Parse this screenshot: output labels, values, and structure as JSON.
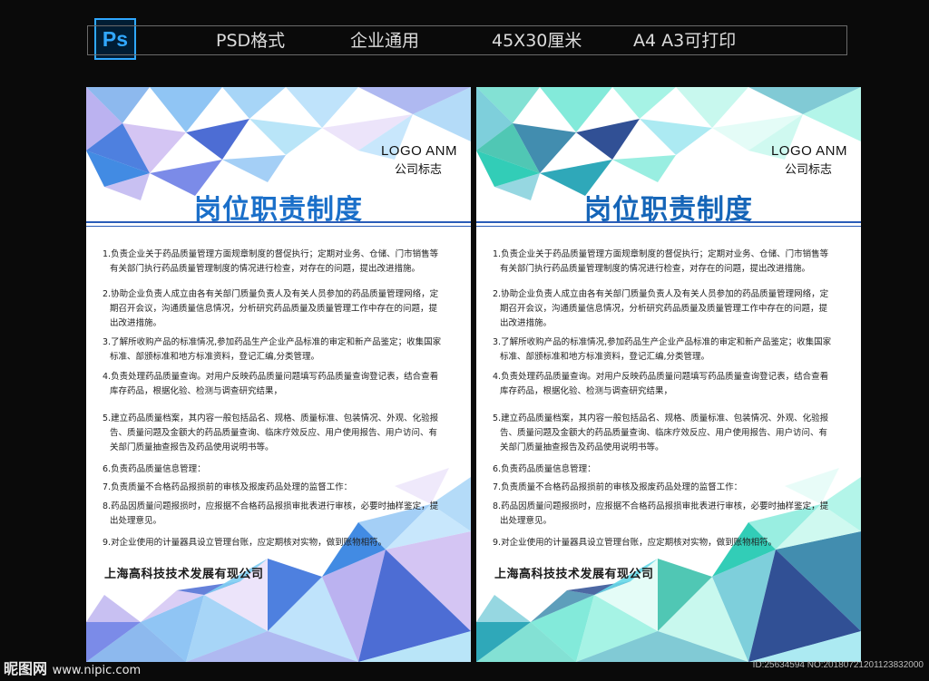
{
  "header": {
    "ps_label": "Ps",
    "format": "PSD格式",
    "usage": "企业通用",
    "size": "45X30厘米",
    "print": "A4 A3可打印"
  },
  "poster": {
    "logo_line1": "LOGO ANM",
    "logo_line2": "公司标志",
    "title": "岗位职责制度",
    "clauses": [
      [
        "1.负责企业关于药品质量管理方面规章制度的督促执行；定期对业务、仓储、门市销售等",
        "有关部门执行药品质量管理制度的情况进行检查，对存在的问题，提出改进措施。"
      ],
      [
        "2.协助企业负责人成立由各有关部门质量负责人及有关人员参加的药品质量管理网络，定",
        "期召开会议，沟通质量信息情况，分析研究药品质量及质量管理工作中存在的问题，提",
        "出改进措施。"
      ],
      [
        "3.了解所收购产品的标准情况,参加药品生产企业产品标准的审定和新产品鉴定；收集国家",
        "标准、部颁标准和地方标准资料，登记汇编,分类管理。"
      ],
      [
        "4.负责处理药品质量查询。对用户反映药品质量问题填写药品质量查询登记表，结合查看",
        "库存药品，根据化验、检测与调查研究结果，"
      ],
      [
        "5.建立药品质量档案，其内容一般包括品名、规格、质量标准、包装情况、外观、化验报",
        "告、质量问题及金额大的药品质量查询、临床疗效反应、用户使用报告、用户访问、有",
        "关部门质量抽查报告及药品使用说明书等。"
      ],
      [
        "6.负责药品质量信息管理："
      ],
      [
        "7.负责质量不合格药品报损前的审核及报废药品处理的监督工作："
      ],
      [
        "8.药品因质量问题报损时，应报据不合格药品报损审批表进行审核，必要时抽样鉴定，提",
        "出处理意见。"
      ],
      [
        "9.对企业使用的计量器具设立管理台账，应定期核对实物，做到账物相符。"
      ]
    ],
    "company": "上海高科技技术发展有现公司"
  },
  "theme": {
    "blue_title": "#1a6fc9",
    "teal_title": "#1565b8",
    "blue_rule": "#2a5db8",
    "teal_rule": "#2a5db8"
  },
  "watermark": {
    "site": "昵图网",
    "url": "www.nipic.com",
    "id": "ID:25634594 NO:20180721201123832000"
  }
}
